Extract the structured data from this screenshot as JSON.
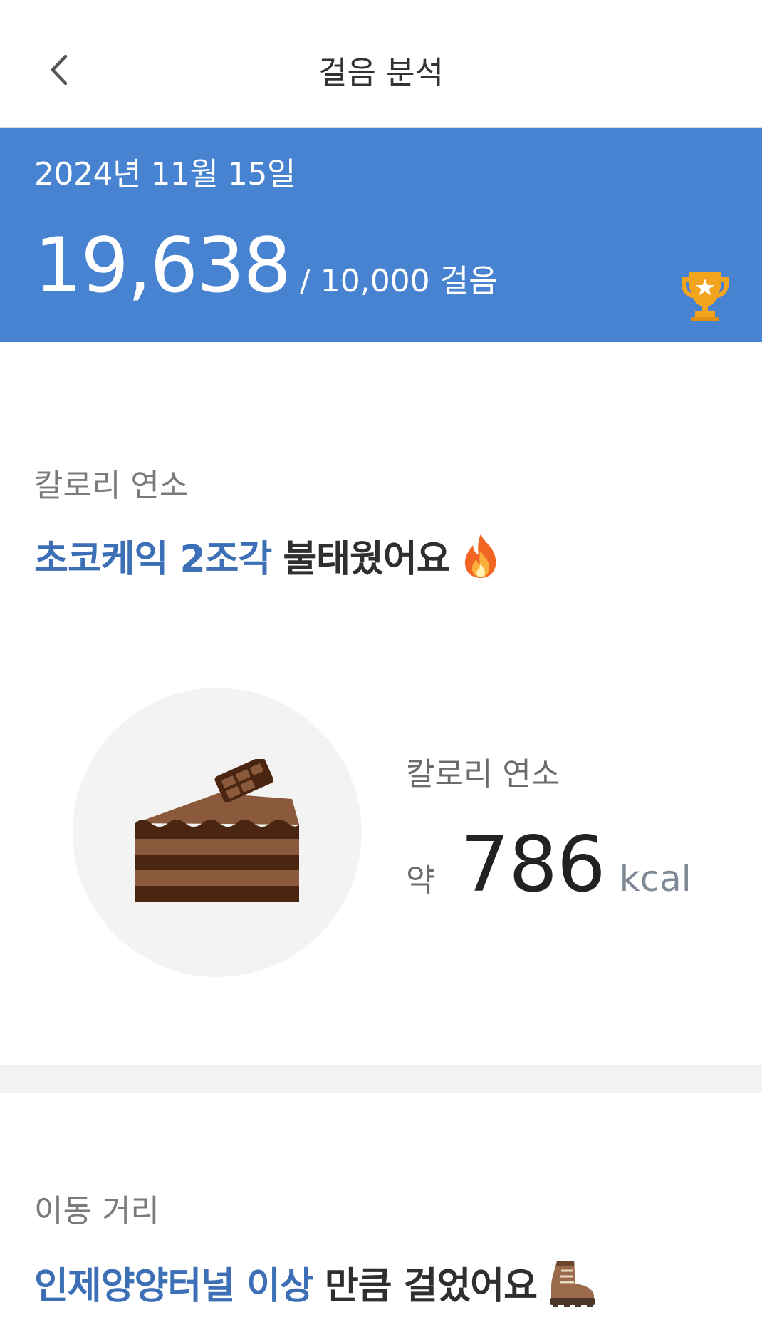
{
  "header": {
    "title": "걸음 분석",
    "back_icon": "chevron-left-icon"
  },
  "banner": {
    "date": "2024년 11월 15일",
    "steps": "19,638",
    "goal": "/ 10,000 걸음",
    "trophy_icon": "trophy-icon",
    "color": "#4783d1"
  },
  "calorie_section": {
    "label": "칼로리 연소",
    "headline_accent": "초코케익 2조각",
    "headline_rest": "불태웠어요",
    "headline_icon": "fire-emoji-icon",
    "illustration": "chocolate-cake-icon",
    "stat_label": "칼로리 연소",
    "stat_prefix": "약",
    "stat_value": "786",
    "stat_unit": "kcal"
  },
  "distance_section": {
    "label": "이동 거리",
    "headline_accent": "인제양양터널 이상",
    "headline_rest": "만큼 걸었어요",
    "headline_icon": "hiking-boot-emoji-icon"
  },
  "colors": {
    "accent": "#3c6fb5",
    "banner": "#4783d1"
  }
}
